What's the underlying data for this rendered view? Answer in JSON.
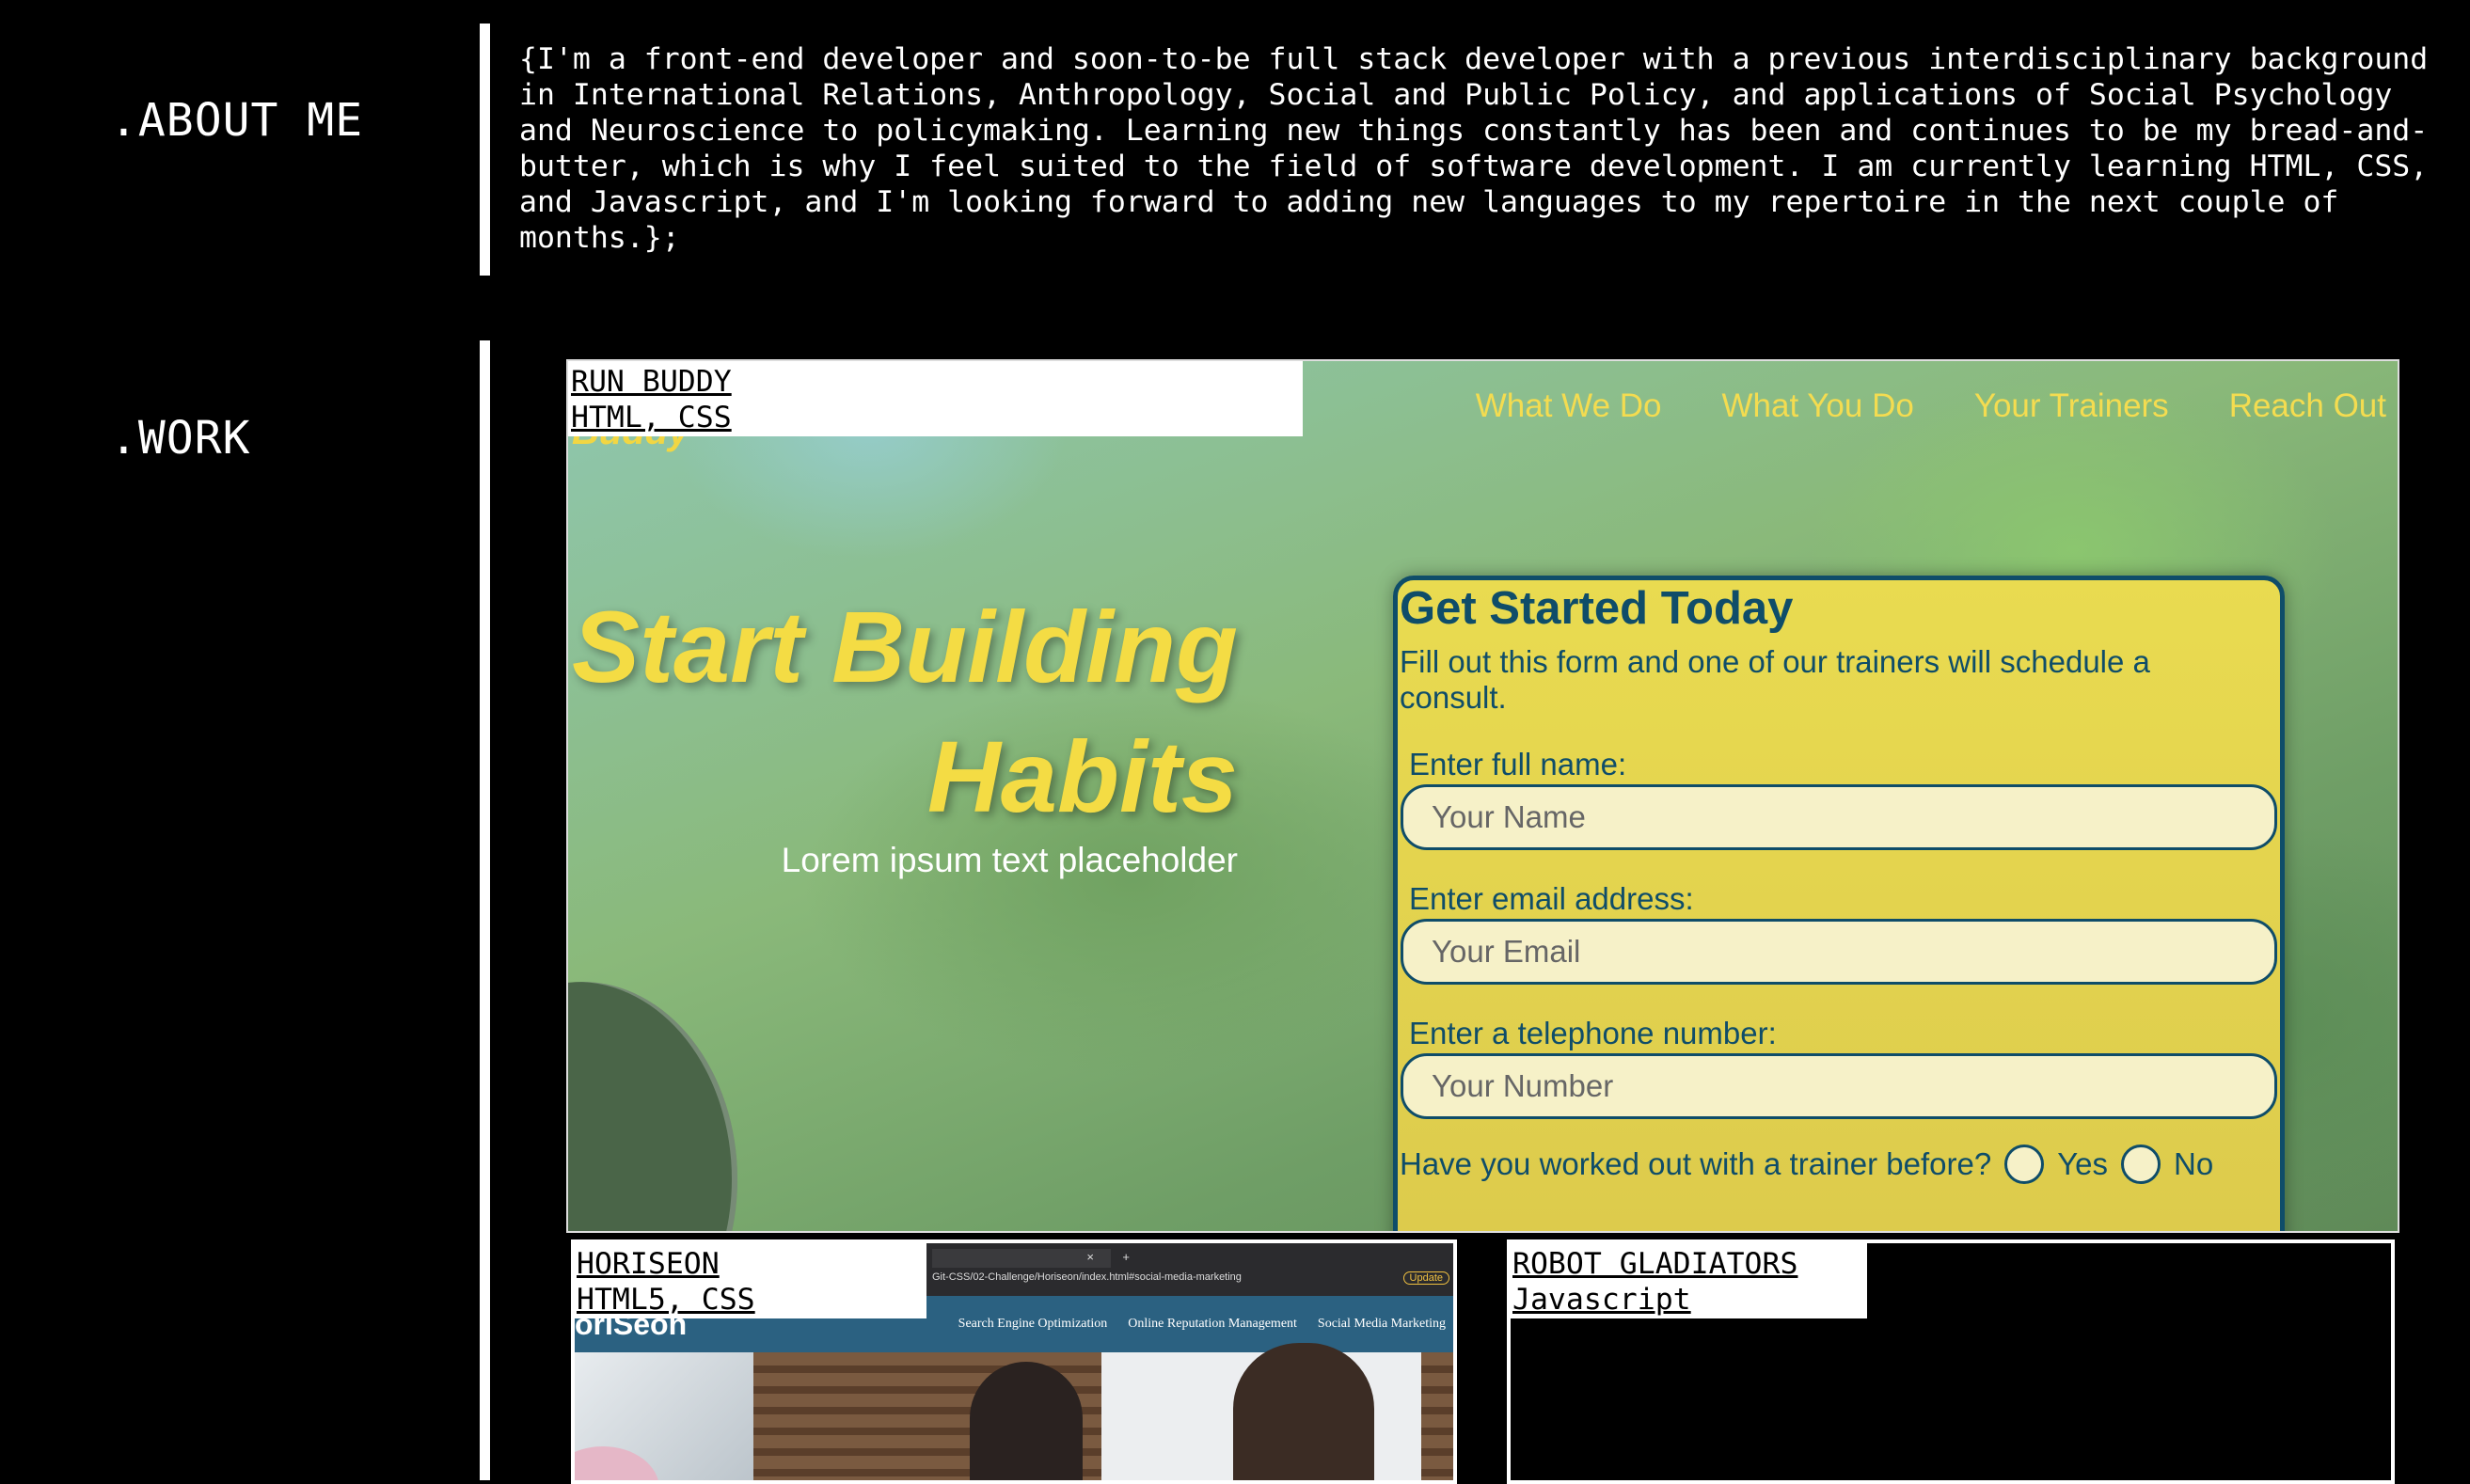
{
  "about": {
    "heading": ".ABOUT ME",
    "text": "{I'm a front-end developer and soon-to-be full stack developer with a previous interdisciplinary background in International Relations, Anthropology, Social and Public Policy, and applications of Social Psychology and Neuroscience to policymaking. Learning new things constantly has been and continues to be my bread-and-butter, which is why I feel suited to the field of software development. I am currently learning HTML, CSS, and Javascript, and I'm looking forward to adding new languages to my repertoire in the next couple of months.};"
  },
  "work": {
    "heading": ".WORK",
    "projects": [
      {
        "name": "RUN BUDDY",
        "tech": "HTML, CSS",
        "preview": {
          "logo_fragment": "Buddy",
          "nav": [
            "What We Do",
            "What You Do",
            "Your Trainers",
            "Reach Out"
          ],
          "hero_line1": "Start Building",
          "hero_line2": "Habits",
          "hero_sub": "Lorem ipsum text placeholder",
          "form": {
            "title": "Get Started Today",
            "intro": "Fill out this form and one of our trainers will schedule a consult.",
            "name_label": "Enter full name:",
            "name_placeholder": "Your Name",
            "email_label": "Enter email address:",
            "email_placeholder": "Your Email",
            "phone_label": "Enter a telephone number:",
            "phone_placeholder": "Your Number",
            "question": "Have you worked out with a trainer before?",
            "yes": "Yes",
            "no": "No"
          }
        }
      },
      {
        "name": "HORISEON",
        "tech": "HTML5, CSS",
        "preview": {
          "tab_close": "×",
          "tab_new": "+",
          "url": "Git-CSS/02-Challenge/Horiseon/index.html#social-media-marketing",
          "update": "Update",
          "logo": "orISeon",
          "nav": [
            "Search Engine Optimization",
            "Online Reputation Management",
            "Social Media Marketing"
          ]
        }
      },
      {
        "name": "ROBOT GLADIATORS",
        "tech": "Javascript"
      }
    ]
  }
}
